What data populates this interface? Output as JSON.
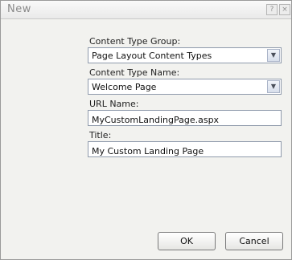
{
  "window": {
    "title": "New",
    "help_glyph": "?",
    "close_glyph": "×"
  },
  "form": {
    "content_type_group": {
      "label": "Content Type Group:",
      "value": "Page Layout Content Types"
    },
    "content_type_name": {
      "label": "Content Type Name:",
      "value": "Welcome Page"
    },
    "url_name": {
      "label": "URL Name:",
      "value": "MyCustomLandingPage.aspx"
    },
    "title": {
      "label": "Title:",
      "value": "My Custom Landing Page"
    }
  },
  "buttons": {
    "ok": "OK",
    "cancel": "Cancel"
  },
  "icons": {
    "dropdown": "chevron-down-icon",
    "help": "help-icon",
    "close": "close-icon"
  }
}
